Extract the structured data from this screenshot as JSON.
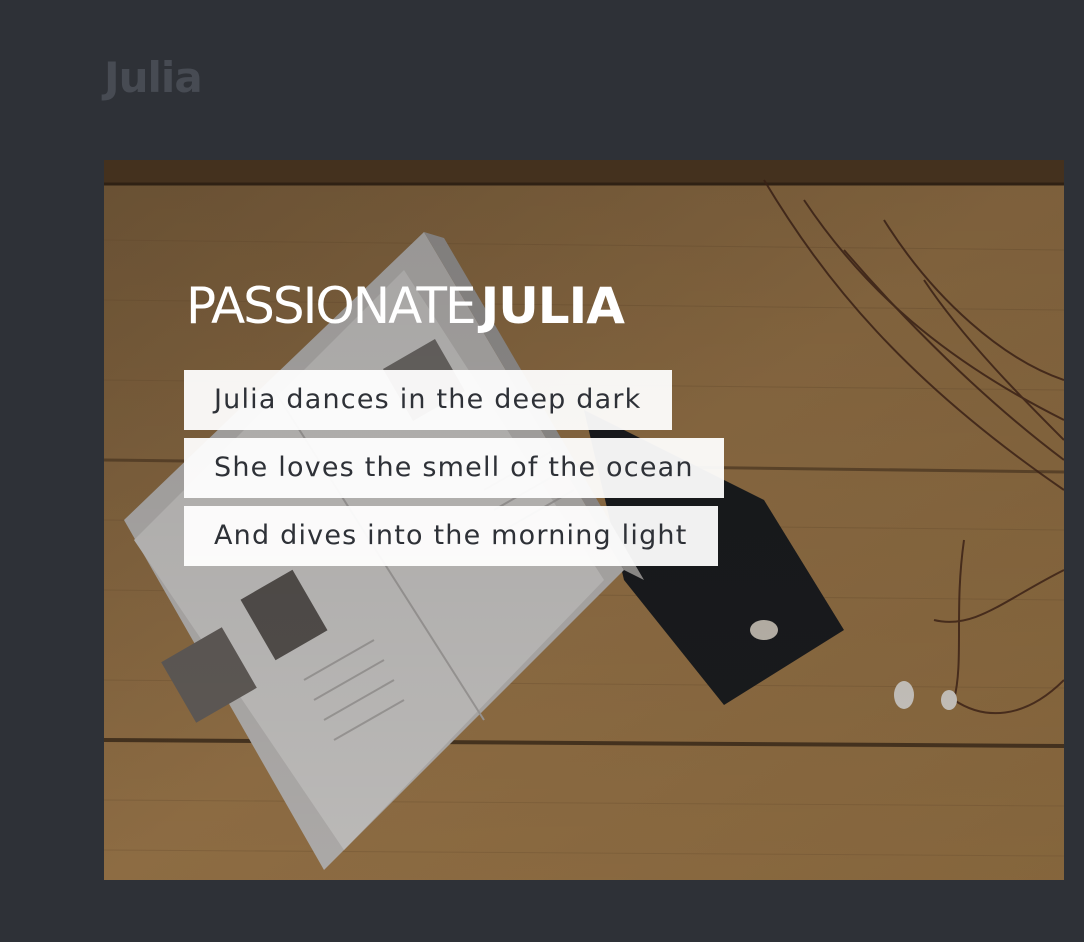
{
  "header": {
    "brand": "Julia"
  },
  "hero": {
    "title_light": "PASSIONATE",
    "title_bold": "JULIA",
    "lines": [
      "Julia dances in the deep dark",
      "She loves the smell of the ocean",
      "And dives into the morning light"
    ]
  },
  "colors": {
    "page_background": "#2e3137",
    "brand_text": "#474b53",
    "line_text": "#2e3137",
    "line_background": "#ffffff",
    "title_text": "#ffffff"
  }
}
